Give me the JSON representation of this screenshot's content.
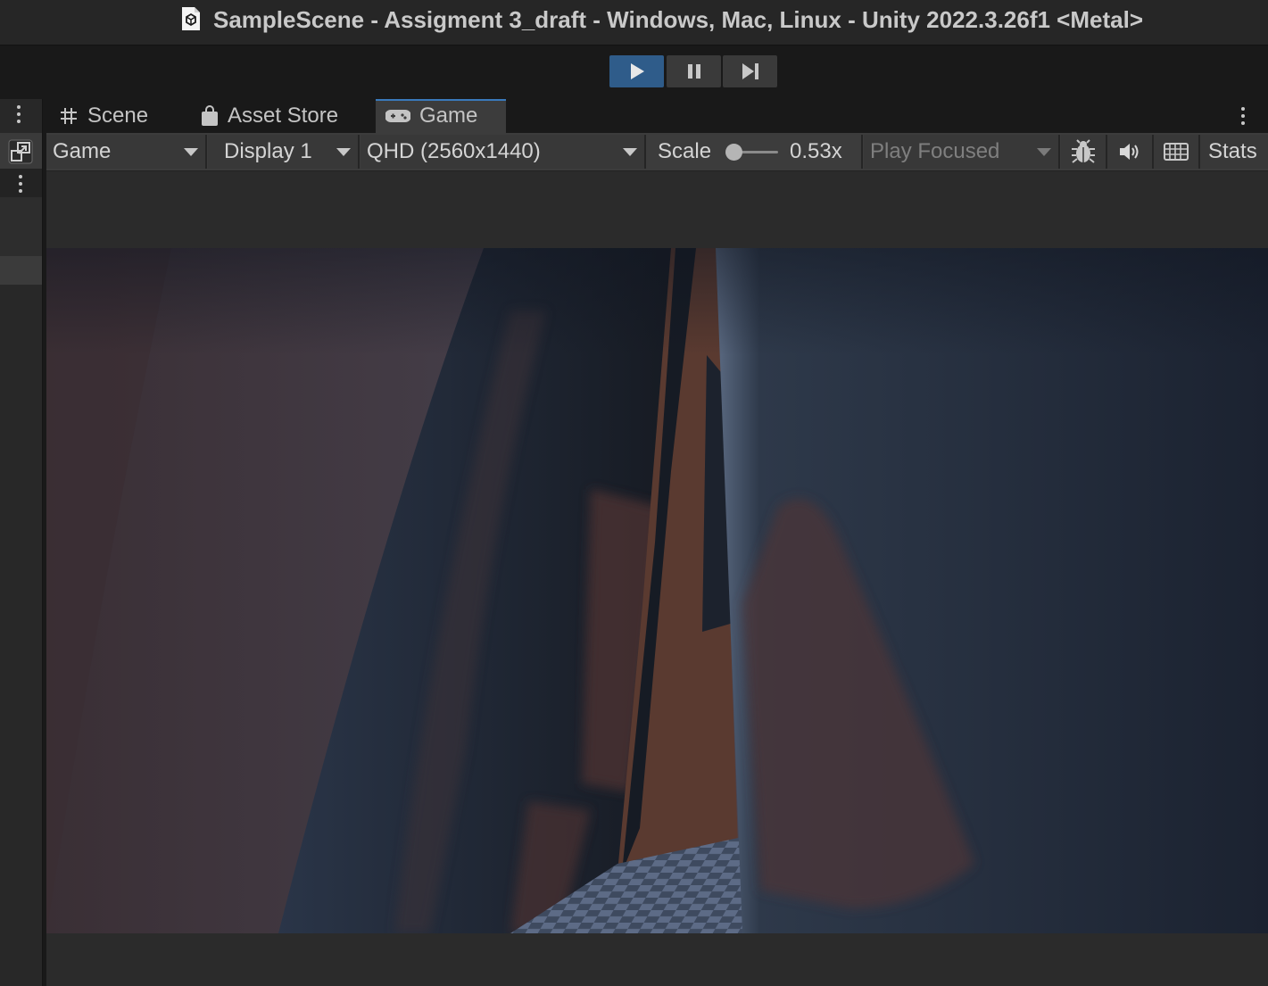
{
  "window": {
    "title": "SampleScene - Assigment 3_draft - Windows, Mac, Linux - Unity 2022.3.26f1 <Metal>"
  },
  "toolbar": {
    "play_icon": "play-icon",
    "pause_icon": "pause-icon",
    "step_icon": "step-icon",
    "play_active": true
  },
  "tabs": [
    {
      "label": "Scene",
      "icon": "grid-hash-icon",
      "active": false
    },
    {
      "label": "Asset Store",
      "icon": "shopping-bag-icon",
      "active": false
    },
    {
      "label": "Game",
      "icon": "gamepad-icon",
      "active": true
    }
  ],
  "game_toolbar": {
    "view_select": "Game",
    "display_select": "Display 1",
    "resolution_select": "QHD (2560x1440)",
    "scale_label": "Scale",
    "scale_value": "0.53x",
    "scale_fraction": 0.0,
    "play_mode_select": "Play Focused",
    "stats_label": "Stats",
    "icons": [
      "bug-icon",
      "audio-icon",
      "keyboard-icon"
    ]
  },
  "colors": {
    "accent": "#3a79bb",
    "play_active_bg": "#2f5c8a",
    "panel_bg": "#3c3c3c",
    "window_bg": "#191919"
  }
}
